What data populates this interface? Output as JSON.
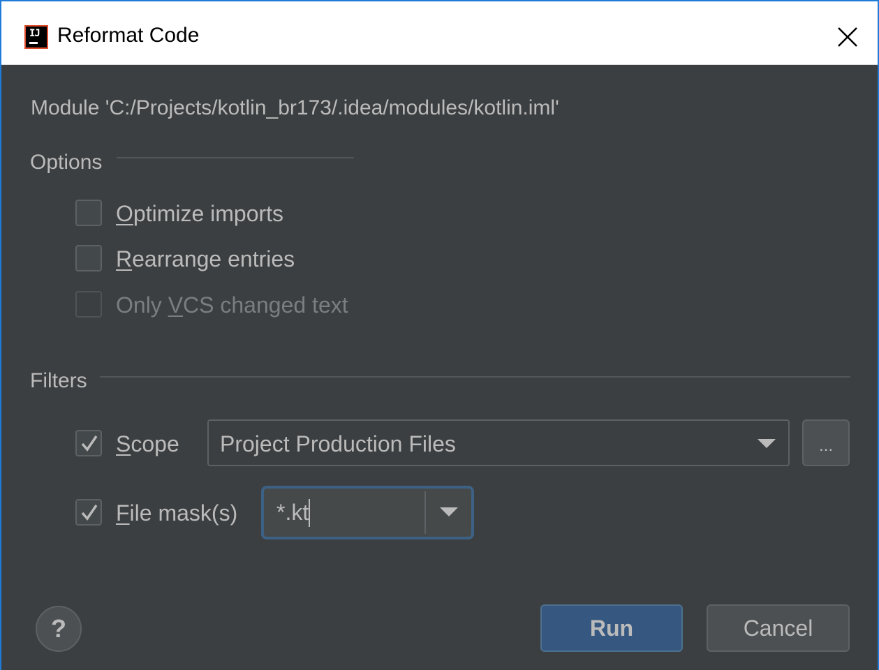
{
  "window": {
    "title": "Reformat Code",
    "app_icon": "intellij-idea-icon",
    "close_icon": "close-icon"
  },
  "module": {
    "text": "Module 'C:/Projects/kotlin_br173/.idea/modules/kotlin.iml'"
  },
  "options": {
    "section_label": "Options",
    "items": [
      {
        "mnemonic": "O",
        "rest": "ptimize imports",
        "checked": false,
        "enabled": true
      },
      {
        "mnemonic": "R",
        "rest": "earrange entries",
        "checked": false,
        "enabled": true
      },
      {
        "prefix": "Only ",
        "mnemonic": "V",
        "rest": "CS changed text",
        "checked": false,
        "enabled": false
      }
    ]
  },
  "filters": {
    "section_label": "Filters",
    "scope": {
      "mnemonic": "S",
      "rest": "cope",
      "checked": true,
      "selected_value": "Project Production Files",
      "browse_label": "..."
    },
    "file_mask": {
      "mnemonic": "F",
      "rest": "ile mask(s)",
      "checked": true,
      "value": "*.kt"
    }
  },
  "footer": {
    "help_label": "?",
    "run_label": "Run",
    "cancel_label": "Cancel"
  },
  "colors": {
    "background": "#3c3f41",
    "text": "#bbbbbb",
    "accent_border": "#1f7bd8",
    "default_button": "#365880",
    "focus_ring": "#3d6185"
  }
}
